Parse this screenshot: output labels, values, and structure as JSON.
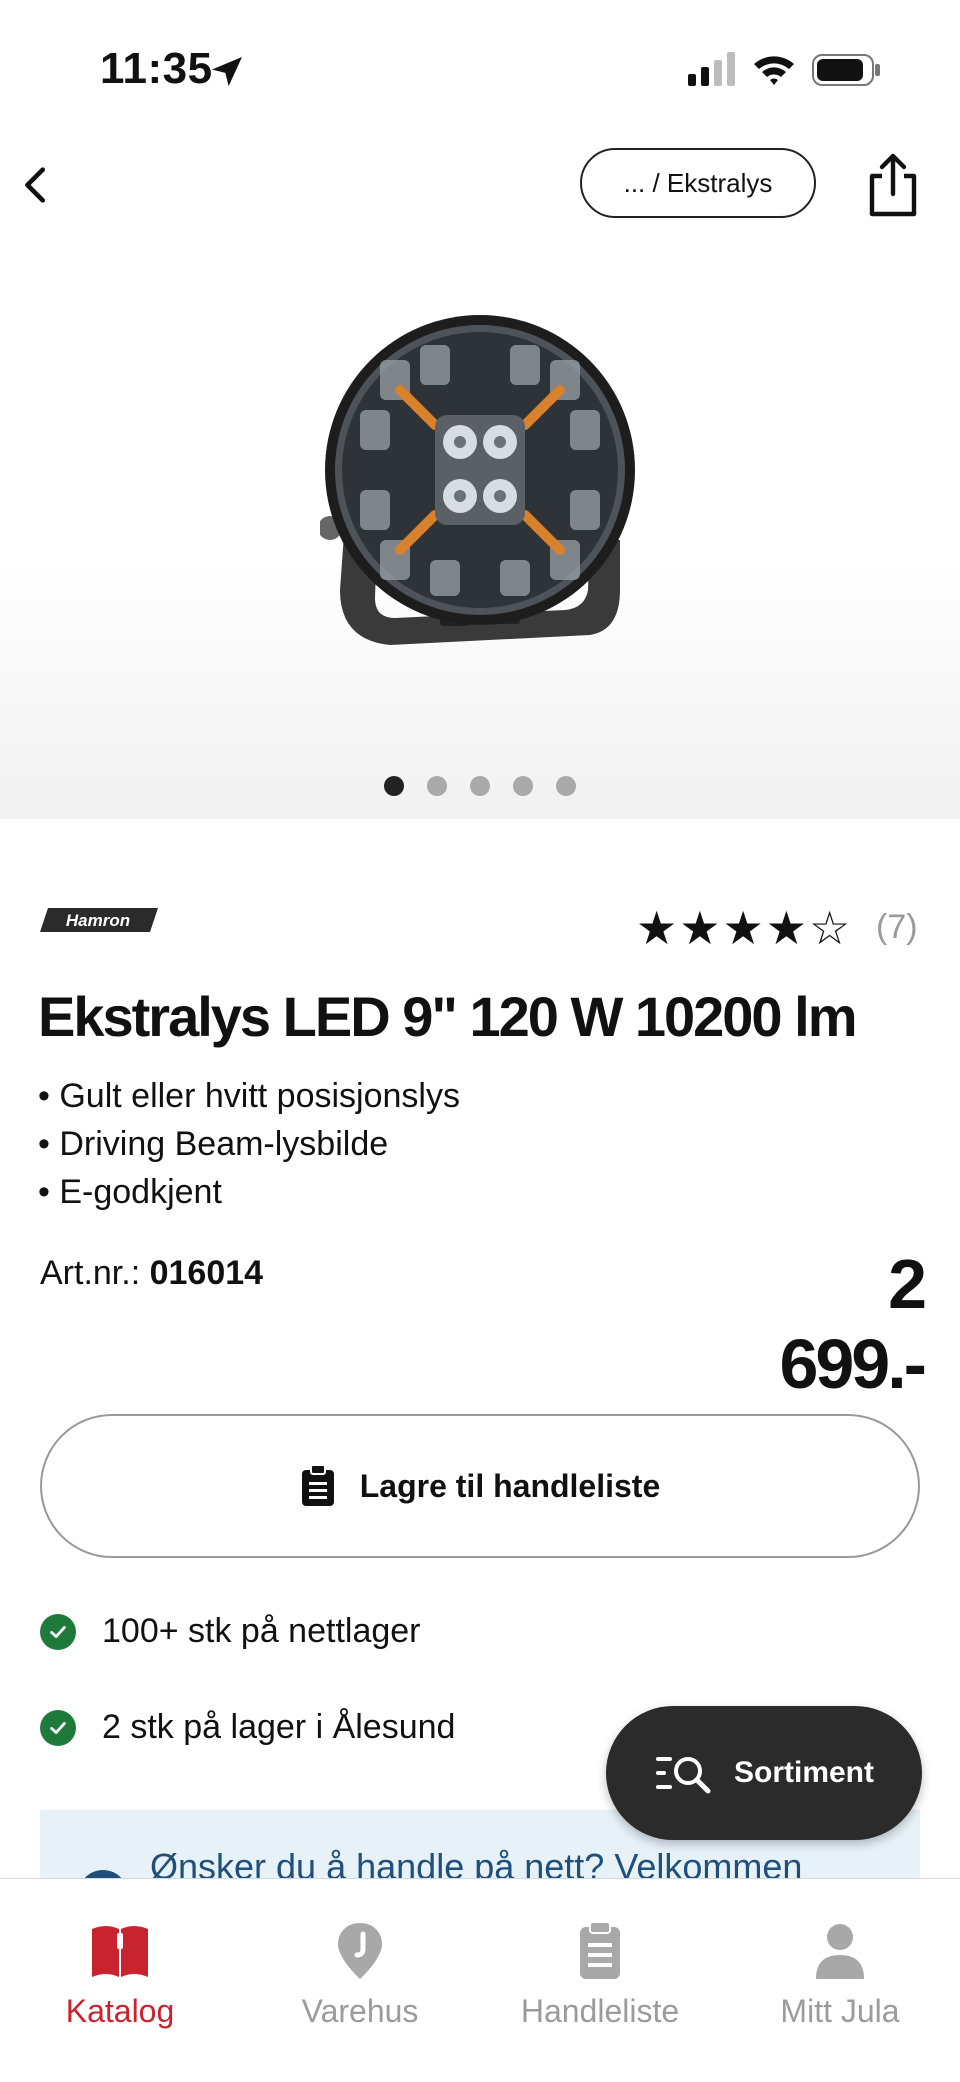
{
  "status_bar": {
    "time": "11:35"
  },
  "nav": {
    "breadcrumb": "... / Ekstralys"
  },
  "gallery": {
    "total_images": 5,
    "active_index": 0
  },
  "product": {
    "brand": "Hamron",
    "rating": 4,
    "rating_max": 5,
    "review_count": "(7)",
    "title": "Ekstralys LED 9\" 120 W 10200 lm",
    "features": [
      "Gult eller hvitt posisjonslys",
      "Driving Beam-lysbilde",
      "E-godkjent"
    ],
    "art_label": "Art.nr.:",
    "art_number": "016014",
    "price": "2 699.-"
  },
  "actions": {
    "save_label": "Lagre til handleliste"
  },
  "stock": [
    {
      "text": "100+ stk på nettlager"
    },
    {
      "text": "2 stk på lager i Ålesund"
    }
  ],
  "banner": {
    "text": "Ønsker du å handle på nett? Velkommen"
  },
  "fab": {
    "label": "Sortiment"
  },
  "tabs": [
    {
      "label": "Katalog",
      "icon": "book-icon",
      "active": true
    },
    {
      "label": "Varehus",
      "icon": "map-pin-icon",
      "active": false
    },
    {
      "label": "Handleliste",
      "icon": "clipboard-icon",
      "active": false
    },
    {
      "label": "Mitt Jula",
      "icon": "person-icon",
      "active": false
    }
  ],
  "colors": {
    "accent": "#c8242f",
    "success": "#1e7a3a",
    "fab_bg": "#2b2b2b",
    "banner_bg": "#e6f1f8"
  }
}
